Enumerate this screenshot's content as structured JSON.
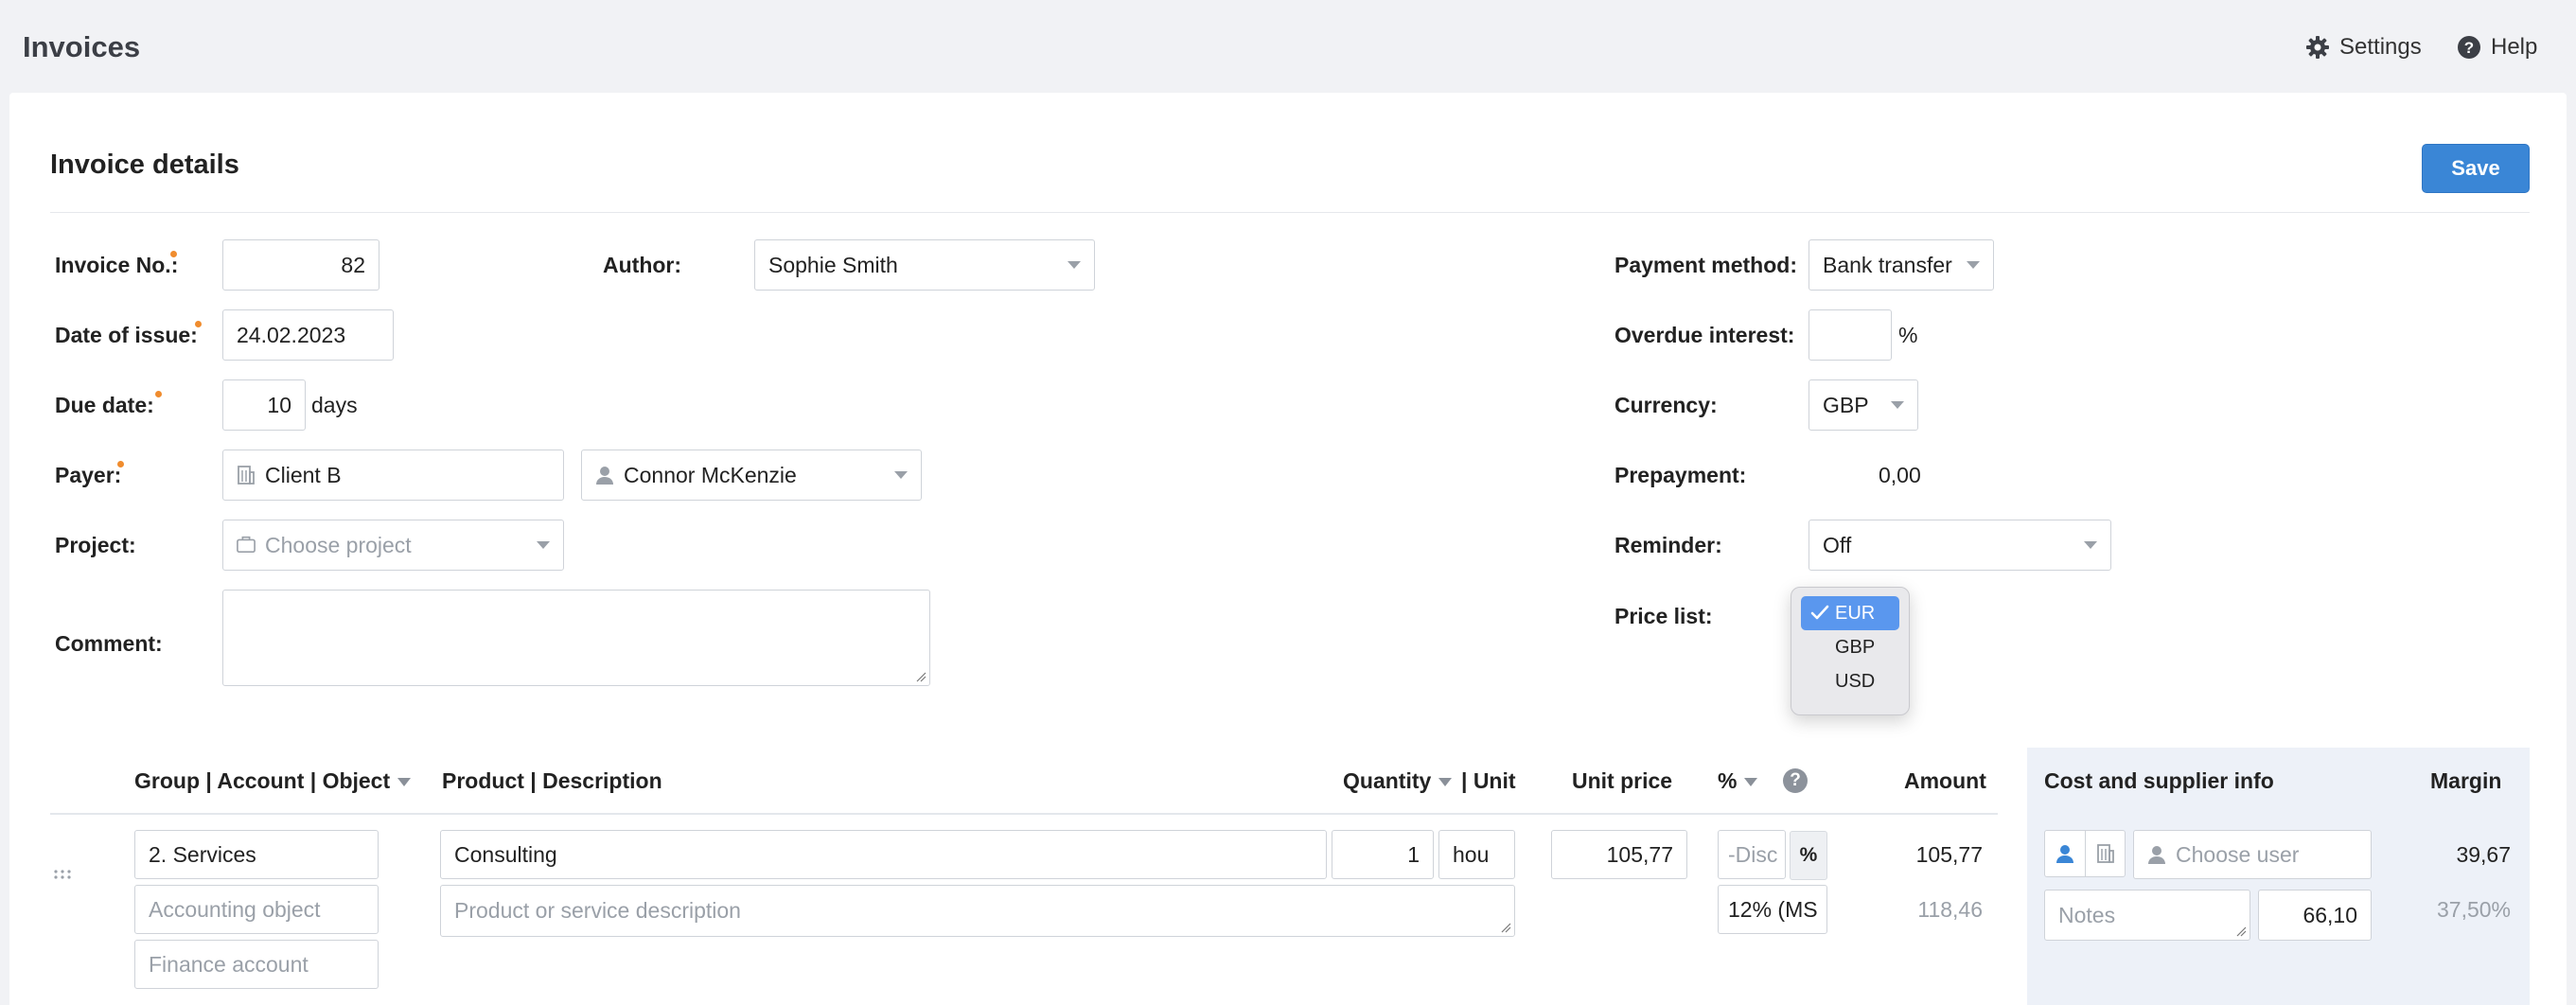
{
  "app": {
    "title": "Invoices",
    "settings_label": "Settings",
    "help_label": "Help",
    "settings_icon": "gear-icon",
    "help_icon": "question-circle-icon"
  },
  "section": {
    "title": "Invoice details",
    "save_label": "Save"
  },
  "form": {
    "invoice_no": {
      "label": "Invoice No.:",
      "value": "82"
    },
    "date_of_issue": {
      "label": "Date of issue:",
      "value": "24.02.2023"
    },
    "due_date": {
      "label": "Due date:",
      "value": "10",
      "unit": "days"
    },
    "payer": {
      "label": "Payer:",
      "client": "Client B",
      "contact": "Connor McKenzie"
    },
    "project": {
      "label": "Project:",
      "placeholder": "Choose project"
    },
    "comment": {
      "label": "Comment:",
      "value": ""
    },
    "author": {
      "label": "Author:",
      "value": "Sophie Smith"
    },
    "payment_method": {
      "label": "Payment method:",
      "value": "Bank transfer"
    },
    "overdue_interest": {
      "label": "Overdue interest:",
      "value": "",
      "unit": "%"
    },
    "currency": {
      "label": "Currency:",
      "value": "GBP"
    },
    "prepayment": {
      "label": "Prepayment:",
      "value": "0,00"
    },
    "reminder": {
      "label": "Reminder:",
      "value": "Off"
    },
    "price_list": {
      "label": "Price list:",
      "options": [
        "EUR",
        "GBP",
        "USD"
      ],
      "selected": "EUR"
    }
  },
  "table": {
    "headers": {
      "group": "Group | Account | Object",
      "product": "Product | Description",
      "quantity": "Quantity",
      "unit": "| Unit",
      "unit_price": "Unit price",
      "percent": "%",
      "amount": "Amount",
      "cost_info": "Cost and supplier info",
      "margin": "Margin"
    },
    "row": {
      "group": "2. Services",
      "accounting_object_placeholder": "Accounting object",
      "finance_account_placeholder": "Finance account",
      "product": "Consulting",
      "description_placeholder": "Product or service description",
      "quantity": "1",
      "unit": "hou",
      "unit_price": "105,77",
      "discount_placeholder": "-Disc",
      "percent_button": "%",
      "tax": "12% (MS",
      "amount": "105,77",
      "amount_with_tax": "118,46",
      "user_placeholder": "Choose user",
      "notes_placeholder": "Notes",
      "cost": "66,10",
      "margin": "39,67",
      "margin_percent": "37,50%"
    }
  },
  "colors": {
    "accent": "#3a86d6",
    "required_dot": "#f08c2e",
    "dropdown_selected": "#5a97ee",
    "side_panel": "#edf1f8"
  }
}
